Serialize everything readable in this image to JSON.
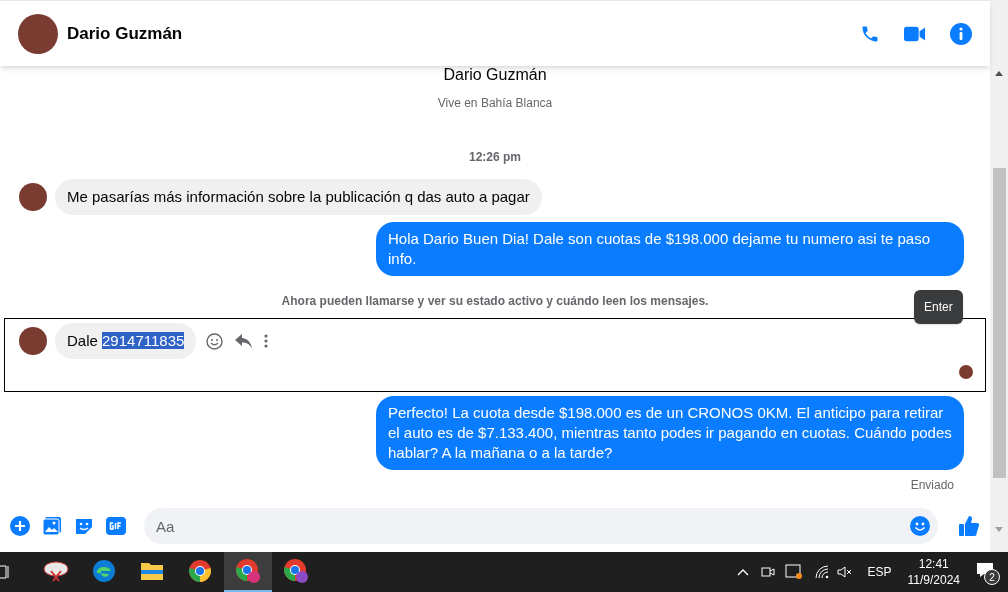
{
  "header": {
    "contact_name": "Dario Guzmán"
  },
  "profile": {
    "name": "Dario Guzmán",
    "subtitle": "Vive en Bahía Blanca"
  },
  "messages": [
    {
      "kind": "time",
      "text": "12:26 pm"
    },
    {
      "kind": "incoming",
      "text": "Me pasarías más información sobre la publicación q das auto a pagar",
      "hovered": false
    },
    {
      "kind": "outgoing",
      "text": "Hola Dario Buen Dia! Dale son cuotas de $198.000 dejame tu numero asi te paso info."
    },
    {
      "kind": "notice",
      "text": "Ahora pueden llamarse y ver su estado activo y cuándo leen los mensajes."
    },
    {
      "kind": "incoming",
      "text": "Dale ",
      "selected_text": "2914711835",
      "hovered": true,
      "seen": true
    },
    {
      "kind": "outgoing",
      "text": "Perfecto! La cuota desde $198.000 es de un CRONOS 0KM. El anticipo para retirar el auto es de $7.133.400, mientras tanto podes ir pagando en cuotas. Cuándo podes hablar? A la mañana o a la tarde?"
    },
    {
      "kind": "status",
      "text": "Enviado"
    }
  ],
  "tooltip": "Enter",
  "composer": {
    "placeholder": "Aa"
  },
  "taskbar": {
    "language": "ESP",
    "time": "12:41",
    "date": "11/9/2024",
    "notifications": "2",
    "apps": [
      {
        "selected": false
      },
      {
        "selected": false
      },
      {
        "selected": false
      },
      {
        "selected": false
      },
      {
        "selected": true
      },
      {
        "selected": false
      }
    ]
  }
}
